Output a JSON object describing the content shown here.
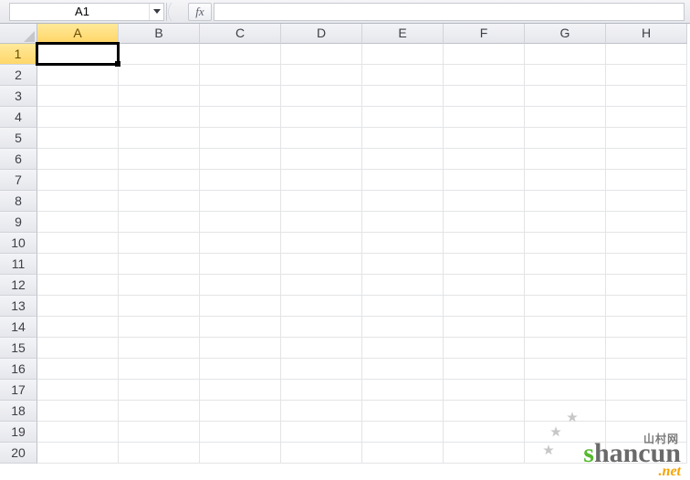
{
  "nameBox": {
    "value": "A1"
  },
  "fxLabel": "fx",
  "formula": {
    "value": ""
  },
  "columns": [
    "A",
    "B",
    "C",
    "D",
    "E",
    "F",
    "G",
    "H"
  ],
  "rows": [
    "1",
    "2",
    "3",
    "4",
    "5",
    "6",
    "7",
    "8",
    "9",
    "10",
    "11",
    "12",
    "13",
    "14",
    "15",
    "16",
    "17",
    "18",
    "19",
    "20"
  ],
  "selection": {
    "col": "A",
    "row": "1",
    "cellValue": ""
  },
  "watermark": {
    "main": "shancun",
    "sub": "山村网",
    "tld": ".net"
  }
}
